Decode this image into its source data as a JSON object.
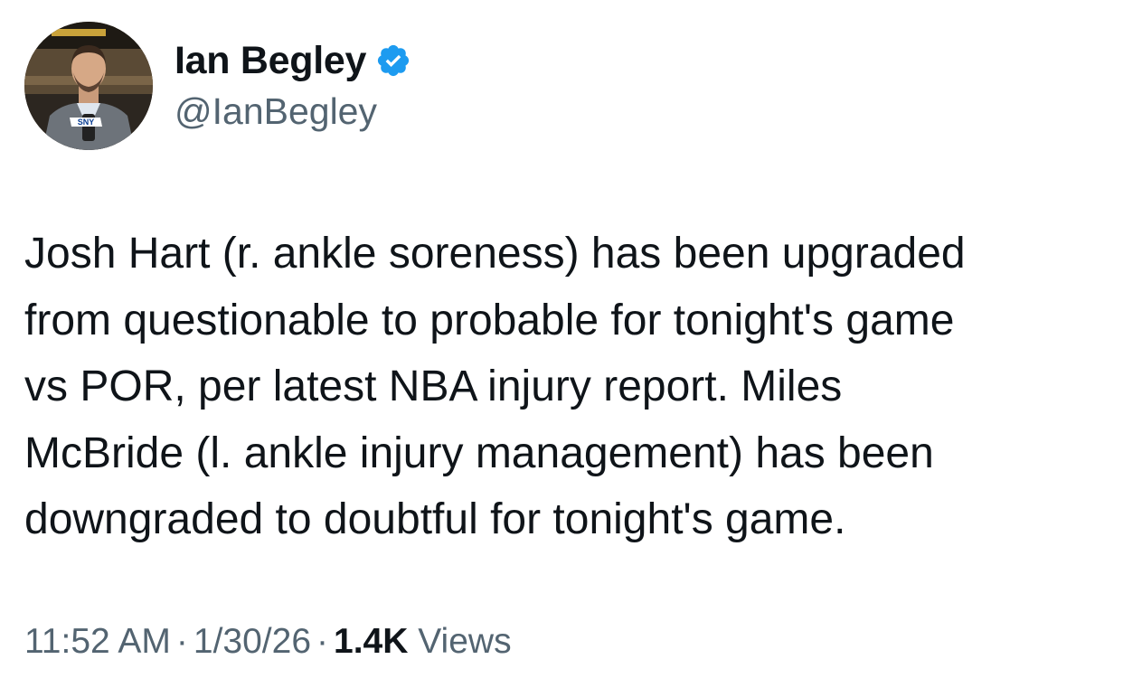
{
  "author": {
    "display_name": "Ian Begley",
    "handle": "@IanBegley",
    "verified": true,
    "avatar_icon": "profile-photo",
    "avatar_mic_label": "SNY"
  },
  "tweet": {
    "text": "Josh Hart (r. ankle soreness) has been upgraded\nfrom questionable to probable for tonight's game\nvs POR, per latest NBA injury report. Miles\nMcBride (l. ankle injury management) has been\ndowngraded to doubtful for tonight's game."
  },
  "meta": {
    "time": "11:52 AM",
    "date": "1/30/26",
    "separator": "·",
    "view_count": "1.4K",
    "views_label": "Views"
  },
  "colors": {
    "text": "#0f1419",
    "secondary": "#536471",
    "verified_badge": "#1d9bf0"
  }
}
